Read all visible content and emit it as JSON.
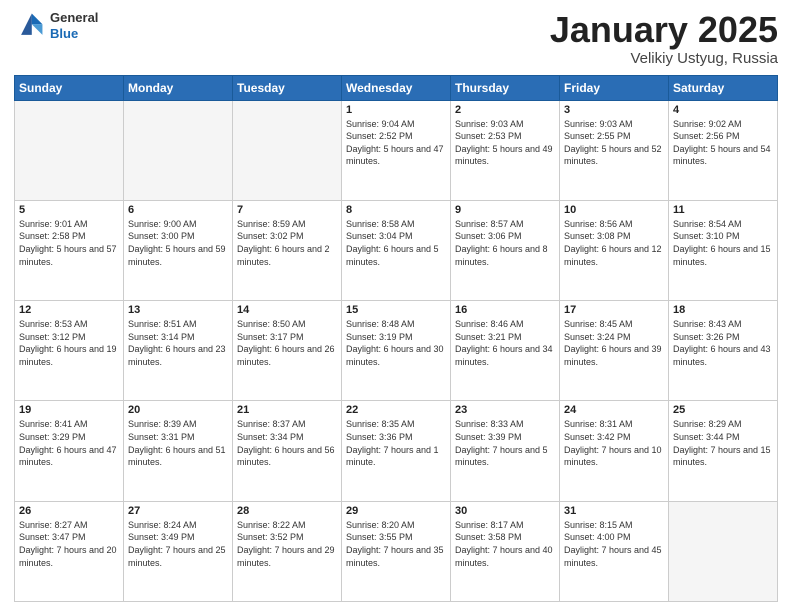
{
  "header": {
    "logo": {
      "general": "General",
      "blue": "Blue"
    },
    "title": "January 2025",
    "subtitle": "Velikiy Ustyug, Russia"
  },
  "columns": [
    "Sunday",
    "Monday",
    "Tuesday",
    "Wednesday",
    "Thursday",
    "Friday",
    "Saturday"
  ],
  "weeks": [
    [
      {
        "day": "",
        "info": ""
      },
      {
        "day": "",
        "info": ""
      },
      {
        "day": "",
        "info": ""
      },
      {
        "day": "1",
        "info": "Sunrise: 9:04 AM\nSunset: 2:52 PM\nDaylight: 5 hours and 47 minutes."
      },
      {
        "day": "2",
        "info": "Sunrise: 9:03 AM\nSunset: 2:53 PM\nDaylight: 5 hours and 49 minutes."
      },
      {
        "day": "3",
        "info": "Sunrise: 9:03 AM\nSunset: 2:55 PM\nDaylight: 5 hours and 52 minutes."
      },
      {
        "day": "4",
        "info": "Sunrise: 9:02 AM\nSunset: 2:56 PM\nDaylight: 5 hours and 54 minutes."
      }
    ],
    [
      {
        "day": "5",
        "info": "Sunrise: 9:01 AM\nSunset: 2:58 PM\nDaylight: 5 hours and 57 minutes."
      },
      {
        "day": "6",
        "info": "Sunrise: 9:00 AM\nSunset: 3:00 PM\nDaylight: 5 hours and 59 minutes."
      },
      {
        "day": "7",
        "info": "Sunrise: 8:59 AM\nSunset: 3:02 PM\nDaylight: 6 hours and 2 minutes."
      },
      {
        "day": "8",
        "info": "Sunrise: 8:58 AM\nSunset: 3:04 PM\nDaylight: 6 hours and 5 minutes."
      },
      {
        "day": "9",
        "info": "Sunrise: 8:57 AM\nSunset: 3:06 PM\nDaylight: 6 hours and 8 minutes."
      },
      {
        "day": "10",
        "info": "Sunrise: 8:56 AM\nSunset: 3:08 PM\nDaylight: 6 hours and 12 minutes."
      },
      {
        "day": "11",
        "info": "Sunrise: 8:54 AM\nSunset: 3:10 PM\nDaylight: 6 hours and 15 minutes."
      }
    ],
    [
      {
        "day": "12",
        "info": "Sunrise: 8:53 AM\nSunset: 3:12 PM\nDaylight: 6 hours and 19 minutes."
      },
      {
        "day": "13",
        "info": "Sunrise: 8:51 AM\nSunset: 3:14 PM\nDaylight: 6 hours and 23 minutes."
      },
      {
        "day": "14",
        "info": "Sunrise: 8:50 AM\nSunset: 3:17 PM\nDaylight: 6 hours and 26 minutes."
      },
      {
        "day": "15",
        "info": "Sunrise: 8:48 AM\nSunset: 3:19 PM\nDaylight: 6 hours and 30 minutes."
      },
      {
        "day": "16",
        "info": "Sunrise: 8:46 AM\nSunset: 3:21 PM\nDaylight: 6 hours and 34 minutes."
      },
      {
        "day": "17",
        "info": "Sunrise: 8:45 AM\nSunset: 3:24 PM\nDaylight: 6 hours and 39 minutes."
      },
      {
        "day": "18",
        "info": "Sunrise: 8:43 AM\nSunset: 3:26 PM\nDaylight: 6 hours and 43 minutes."
      }
    ],
    [
      {
        "day": "19",
        "info": "Sunrise: 8:41 AM\nSunset: 3:29 PM\nDaylight: 6 hours and 47 minutes."
      },
      {
        "day": "20",
        "info": "Sunrise: 8:39 AM\nSunset: 3:31 PM\nDaylight: 6 hours and 51 minutes."
      },
      {
        "day": "21",
        "info": "Sunrise: 8:37 AM\nSunset: 3:34 PM\nDaylight: 6 hours and 56 minutes."
      },
      {
        "day": "22",
        "info": "Sunrise: 8:35 AM\nSunset: 3:36 PM\nDaylight: 7 hours and 1 minute."
      },
      {
        "day": "23",
        "info": "Sunrise: 8:33 AM\nSunset: 3:39 PM\nDaylight: 7 hours and 5 minutes."
      },
      {
        "day": "24",
        "info": "Sunrise: 8:31 AM\nSunset: 3:42 PM\nDaylight: 7 hours and 10 minutes."
      },
      {
        "day": "25",
        "info": "Sunrise: 8:29 AM\nSunset: 3:44 PM\nDaylight: 7 hours and 15 minutes."
      }
    ],
    [
      {
        "day": "26",
        "info": "Sunrise: 8:27 AM\nSunset: 3:47 PM\nDaylight: 7 hours and 20 minutes."
      },
      {
        "day": "27",
        "info": "Sunrise: 8:24 AM\nSunset: 3:49 PM\nDaylight: 7 hours and 25 minutes."
      },
      {
        "day": "28",
        "info": "Sunrise: 8:22 AM\nSunset: 3:52 PM\nDaylight: 7 hours and 29 minutes."
      },
      {
        "day": "29",
        "info": "Sunrise: 8:20 AM\nSunset: 3:55 PM\nDaylight: 7 hours and 35 minutes."
      },
      {
        "day": "30",
        "info": "Sunrise: 8:17 AM\nSunset: 3:58 PM\nDaylight: 7 hours and 40 minutes."
      },
      {
        "day": "31",
        "info": "Sunrise: 8:15 AM\nSunset: 4:00 PM\nDaylight: 7 hours and 45 minutes."
      },
      {
        "day": "",
        "info": ""
      }
    ]
  ]
}
